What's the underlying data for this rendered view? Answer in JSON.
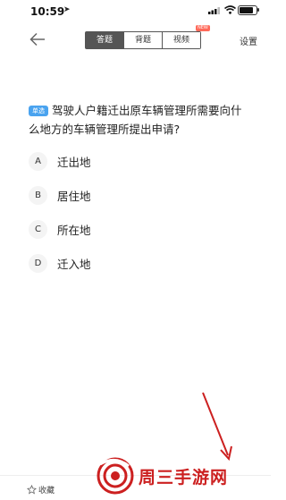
{
  "status_bar": {
    "time": "10:59"
  },
  "header": {
    "tabs": [
      {
        "label": "答题",
        "active": true
      },
      {
        "label": "背题",
        "active": false
      },
      {
        "label": "视频",
        "active": false
      }
    ],
    "new_badge": "NEW",
    "settings_label": "设置"
  },
  "question": {
    "type_badge": "单选",
    "text": "驾驶人户籍迁出原车辆管理所需要向什么地方的车辆管理所提出申请?",
    "options": [
      {
        "letter": "A",
        "text": "迁出地"
      },
      {
        "letter": "B",
        "text": "居住地"
      },
      {
        "letter": "C",
        "text": "所在地"
      },
      {
        "letter": "D",
        "text": "迁入地"
      }
    ]
  },
  "footer": {
    "favorite_label": "收藏"
  },
  "watermark": {
    "text": "周三手游网"
  },
  "colors": {
    "tab_active": "#555555",
    "badge": "#4aa3ef",
    "watermark": "#cc2020"
  }
}
